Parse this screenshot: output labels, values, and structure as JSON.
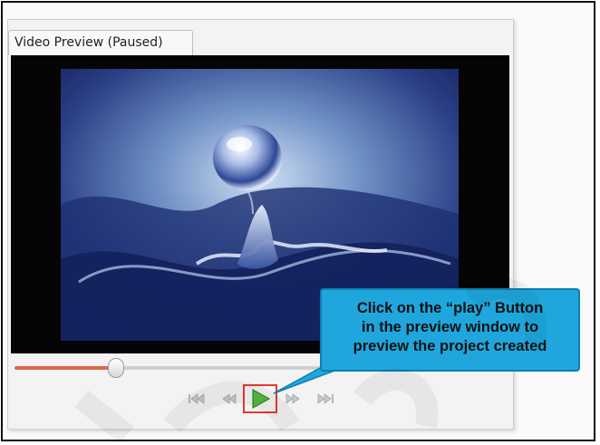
{
  "window": {
    "tab_title": "Video Preview (Paused)"
  },
  "player": {
    "state": "paused",
    "progress": 0.21,
    "accent_color": "#e2664a",
    "controls": [
      {
        "name": "skip-to-start",
        "icon": "skip-start-icon"
      },
      {
        "name": "rewind",
        "icon": "rewind-icon"
      },
      {
        "name": "play",
        "icon": "play-icon"
      },
      {
        "name": "fast-forward",
        "icon": "fast-forward-icon"
      },
      {
        "name": "skip-to-end",
        "icon": "skip-end-icon"
      }
    ]
  },
  "callout": {
    "line1": "Click on the “play” Button",
    "line2": "in the preview window to",
    "line3": "preview the project created",
    "color": "#1fa7dd"
  },
  "highlight": {
    "color": "#e53935"
  }
}
